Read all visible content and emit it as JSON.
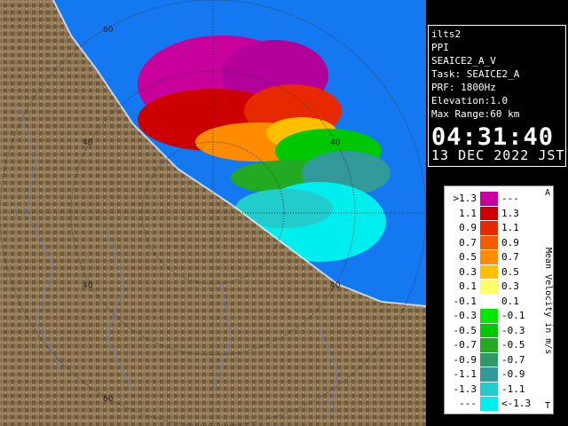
{
  "info": {
    "site": "ilts2",
    "mode": "PPI",
    "product": "SEAICE2_A_V",
    "task": "Task: SEAICE2_A",
    "prf": "PRF: 1800Hz",
    "elevation": "Elevation:1.0",
    "max_range": "Max Range:60 km",
    "time": "04:31:40",
    "date": "13 DEC 2022 JST"
  },
  "legend": {
    "title": "Mean Velocity in m/s",
    "top_tag": "A",
    "bottom_tag": "T",
    "rows": [
      {
        "left": ">1.3",
        "right": "---",
        "color": "#c8009c"
      },
      {
        "left": "1.1",
        "right": "1.3",
        "color": "#cc0000"
      },
      {
        "left": "0.9",
        "right": "1.1",
        "color": "#e82800"
      },
      {
        "left": "0.7",
        "right": "0.9",
        "color": "#f85a00"
      },
      {
        "left": "0.5",
        "right": "0.7",
        "color": "#ff8c00"
      },
      {
        "left": "0.3",
        "right": "0.5",
        "color": "#ffbe00"
      },
      {
        "left": "0.1",
        "right": "0.3",
        "color": "#ffff66"
      },
      {
        "left": "-0.1",
        "right": "0.1",
        "color": "#ffffff"
      },
      {
        "left": "-0.3",
        "right": "-0.1",
        "color": "#00e800"
      },
      {
        "left": "-0.5",
        "right": "-0.3",
        "color": "#00c800"
      },
      {
        "left": "-0.7",
        "right": "-0.5",
        "color": "#22aa22"
      },
      {
        "left": "-0.9",
        "right": "-0.7",
        "color": "#2e9a6a"
      },
      {
        "left": "-1.1",
        "right": "-0.9",
        "color": "#339a9a"
      },
      {
        "left": "-1.3",
        "right": "-1.1",
        "color": "#22cccc"
      },
      {
        "left": "---",
        "right": "<-1.3",
        "color": "#00eeee"
      }
    ]
  },
  "range_labels": [
    "60",
    "40",
    "40",
    "40",
    "40",
    "60"
  ],
  "colors": {
    "sea": "#1478f0",
    "land": "#8a7150",
    "ring": "#333333"
  }
}
